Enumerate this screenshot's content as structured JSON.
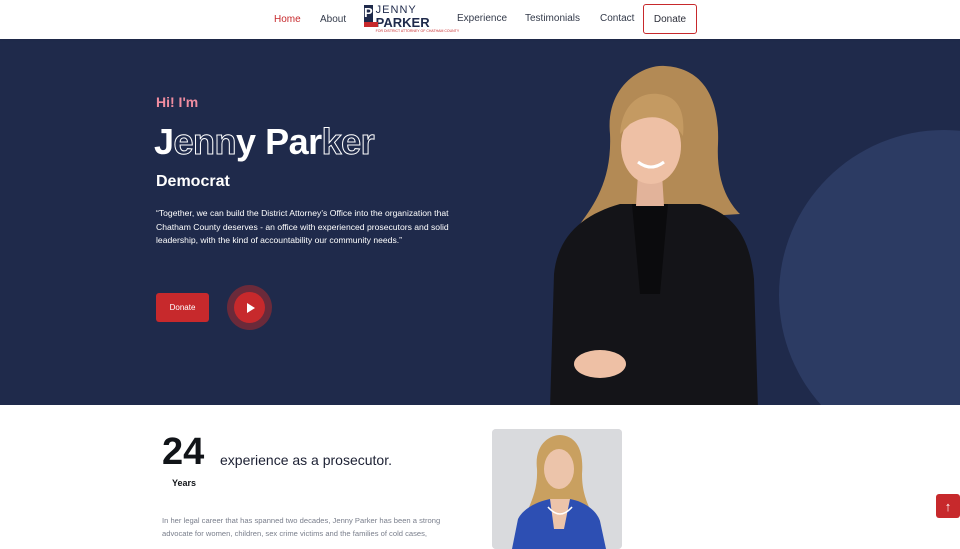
{
  "nav": {
    "items": [
      "Home",
      "About",
      "Experience",
      "Testimonials",
      "Contact"
    ],
    "donate_label": "Donate",
    "active": "Home",
    "logo": {
      "first_name": "JENNY",
      "last_name": "PARKER",
      "tagline": "FOR DISTRICT ATTORNEY OF CHATHAM COUNTY"
    }
  },
  "hero": {
    "greeting": "Hi! I'm",
    "name_solid_1": "J",
    "name_outline_1": "enn",
    "name_solid_2": "y Par",
    "name_outline_2": "ker",
    "party": "Democrat",
    "quote": "“Together, we can build the District Attorney’s Office into the organization that Chatham County deserves - an office with experienced prosecutors and solid leadership, with the kind of accountability our community needs.”",
    "donate_label": "Donate",
    "play_icon": "play-icon"
  },
  "experience": {
    "years": "24",
    "years_label": "Years",
    "headline": "experience as a prosecutor.",
    "bio": "In her legal career that has spanned two decades, Jenny Parker has been a strong advocate for women, children, sex crime victims and the families of cold cases,"
  },
  "scroll_top_icon": "arrow-up-icon",
  "colors": {
    "accent": "#c7292c",
    "navy": "#1f2a4b",
    "greeting_pink": "#f08da0"
  }
}
